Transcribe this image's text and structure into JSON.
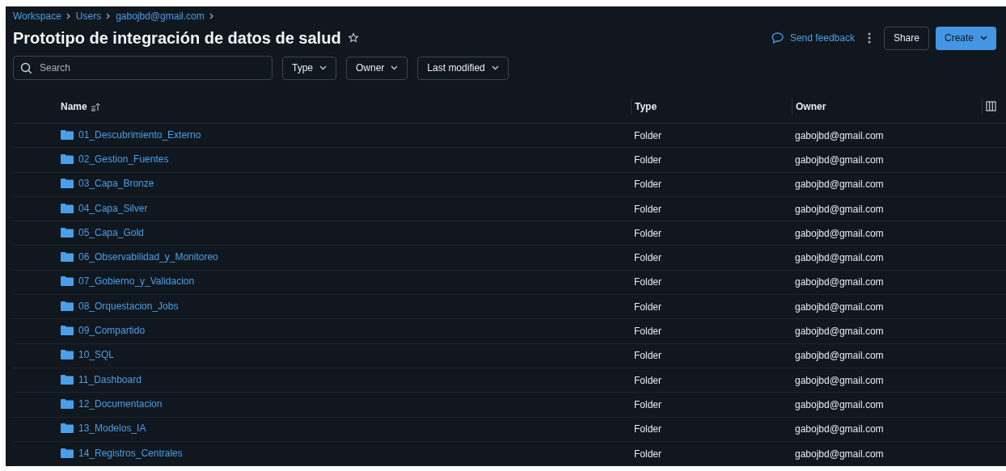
{
  "breadcrumb": [
    "Workspace",
    "Users",
    "gabojbd@gmail.com"
  ],
  "title": "Prototipo de integración de datos de salud",
  "starred": false,
  "actions": {
    "feedback": "Send feedback",
    "share": "Share",
    "create": "Create"
  },
  "search": {
    "placeholder": "Search"
  },
  "filters": [
    "Type",
    "Owner",
    "Last modified"
  ],
  "table": {
    "columns": [
      "Name",
      "Type",
      "Owner"
    ],
    "rows": [
      {
        "name": "01_Descubrimiento_Externo",
        "type": "Folder",
        "owner": "gabojbd@gmail.com"
      },
      {
        "name": "02_Gestion_Fuentes",
        "type": "Folder",
        "owner": "gabojbd@gmail.com"
      },
      {
        "name": "03_Capa_Bronze",
        "type": "Folder",
        "owner": "gabojbd@gmail.com"
      },
      {
        "name": "04_Capa_Silver",
        "type": "Folder",
        "owner": "gabojbd@gmail.com"
      },
      {
        "name": "05_Capa_Gold",
        "type": "Folder",
        "owner": "gabojbd@gmail.com"
      },
      {
        "name": "06_Observabilidad_y_Monitoreo",
        "type": "Folder",
        "owner": "gabojbd@gmail.com"
      },
      {
        "name": "07_Gobierno_y_Validacion",
        "type": "Folder",
        "owner": "gabojbd@gmail.com"
      },
      {
        "name": "08_Orquestacion_Jobs",
        "type": "Folder",
        "owner": "gabojbd@gmail.com"
      },
      {
        "name": "09_Compartido",
        "type": "Folder",
        "owner": "gabojbd@gmail.com"
      },
      {
        "name": "10_SQL",
        "type": "Folder",
        "owner": "gabojbd@gmail.com"
      },
      {
        "name": "11_Dashboard",
        "type": "Folder",
        "owner": "gabojbd@gmail.com"
      },
      {
        "name": "12_Documentacion",
        "type": "Folder",
        "owner": "gabojbd@gmail.com"
      },
      {
        "name": "13_Modelos_IA",
        "type": "Folder",
        "owner": "gabojbd@gmail.com"
      },
      {
        "name": "14_Registros_Centrales",
        "type": "Folder",
        "owner": "gabojbd@gmail.com"
      }
    ]
  }
}
